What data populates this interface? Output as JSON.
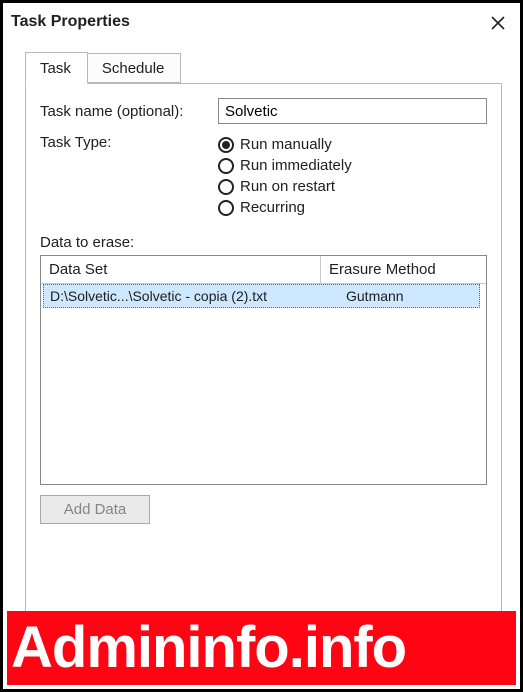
{
  "window": {
    "title": "Task Properties"
  },
  "tabs": {
    "task": "Task",
    "schedule": "Schedule"
  },
  "form": {
    "taskname_label": "Task name (optional):",
    "taskname_value": "Solvetic",
    "tasktype_label": "Task Type:",
    "radio": {
      "manual": "Run manually",
      "immediate": "Run immediately",
      "restart": "Run on restart",
      "recurring": "Recurring"
    },
    "selected_radio": "manual"
  },
  "data_section": {
    "label": "Data to erase:",
    "columns": {
      "dataset": "Data Set",
      "method": "Erasure Method"
    },
    "rows": [
      {
        "dataset": "D:\\Solvetic...\\Solvetic - copia (2).txt",
        "method": "Gutmann"
      }
    ]
  },
  "buttons": {
    "add_data": "Add Data"
  },
  "watermark": "Admininfo.info"
}
